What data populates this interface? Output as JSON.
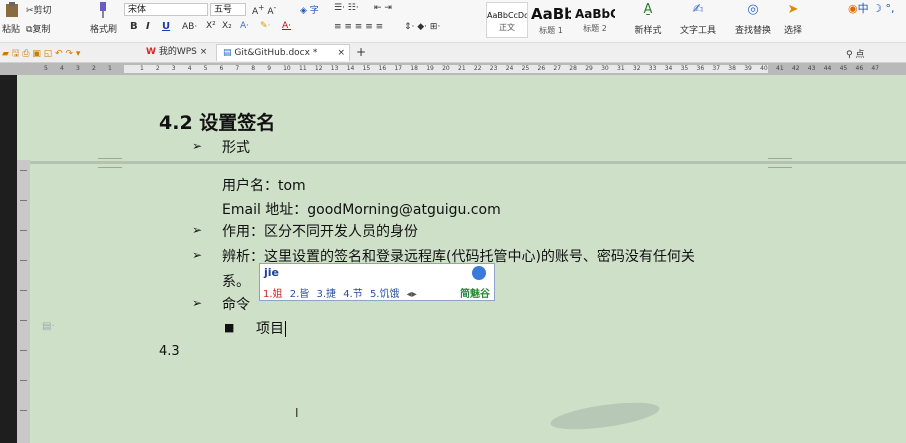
{
  "ribbon": {
    "paste": "粘贴",
    "cut": "剪切",
    "copy": "复制",
    "format_painter": "格式刷",
    "font_name": "宋体",
    "font_size": "五号",
    "styles": [
      {
        "preview": "AaBbCcDd",
        "name": "正文"
      },
      {
        "preview": "AaBb",
        "name": "标题 1"
      },
      {
        "preview": "AaBbC",
        "name": "标题 2"
      }
    ],
    "new_style": "新样式",
    "text_tools": "文字工具",
    "find_replace": "查找替换",
    "select": "选择",
    "ime_status": "中"
  },
  "tabs": {
    "home": "我的WPS",
    "doc": "Git&GitHub.docx *"
  },
  "ruler": {
    "left_numbers": [
      "5",
      "4",
      "3",
      "2",
      "1"
    ],
    "numbers": [
      "1",
      "2",
      "3",
      "4",
      "5",
      "6",
      "7",
      "8",
      "9",
      "10",
      "11",
      "12",
      "13",
      "14",
      "15",
      "16",
      "17",
      "18",
      "19",
      "20",
      "21",
      "22",
      "23",
      "24",
      "25",
      "26",
      "27",
      "28",
      "29",
      "30",
      "31",
      "32",
      "33",
      "34",
      "35",
      "36",
      "37",
      "38",
      "39",
      "40",
      "41",
      "42",
      "43",
      "44",
      "45",
      "46",
      "47"
    ]
  },
  "document": {
    "heading": "4.2 设置签名",
    "bullet_form": "形式",
    "username_line": "用户名：tom",
    "email_line": "Email 地址：goodMorning@atguigu.com",
    "purpose_line": "作用：区分不同开发人员的身份",
    "analysis_line1": "辨析：这里设置的签名和登录远程库(代码托管中心)的账号、密码没有任何关",
    "analysis_line2": "系。",
    "command_line": "命令",
    "item_line": "项目",
    "next_heading": "4.3"
  },
  "ime": {
    "input": "jie",
    "candidates": [
      "1.姐",
      "2.皆",
      "3.捷",
      "4.节",
      "5.饥饿"
    ],
    "brand": "简魅谷"
  }
}
